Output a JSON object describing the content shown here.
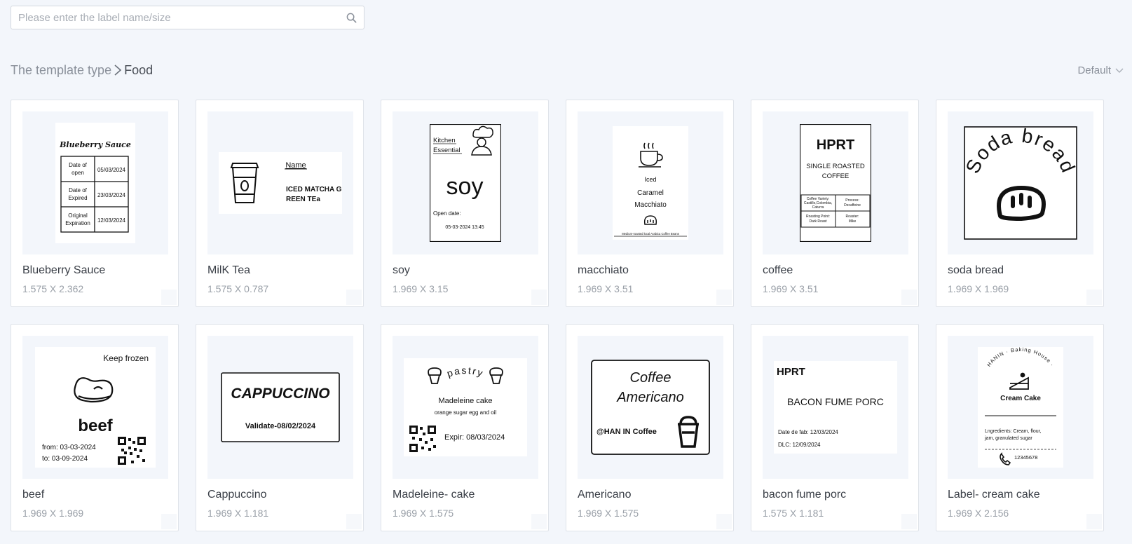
{
  "search": {
    "placeholder": "Please enter the label name/size",
    "icon": "search-icon"
  },
  "breadcrumb": {
    "root": "The template type",
    "current": "Food"
  },
  "sort": {
    "label": "Default"
  },
  "templates": [
    {
      "name": "Blueberry Sauce",
      "size": "1.575 X 2.362",
      "label": {
        "title": "Blueberry Sauce",
        "rows": [
          {
            "k": [
              "Date of",
              "open"
            ],
            "v": "05/03/2024"
          },
          {
            "k": [
              "Date of",
              "Expired"
            ],
            "v": "23/03/2024"
          },
          {
            "k": [
              "Original",
              "Expiration"
            ],
            "v": "12/03/2024"
          }
        ]
      }
    },
    {
      "name": "MilK Tea",
      "size": "1.575 X 0.787",
      "label": {
        "heading": "Name",
        "line1": "ICED MATCHA G",
        "line2": "REEN TEa"
      }
    },
    {
      "name": "soy",
      "size": "1.969 X 3.15",
      "label": {
        "top1": "Kitchen",
        "top2": "Essential",
        "big": "soy",
        "open": "Open date:",
        "date": "05-03-2024  13:45"
      }
    },
    {
      "name": "macchiato",
      "size": "1.969 X 3.51",
      "label": {
        "l1": "Iced",
        "l2": "Caramel",
        "l3": "Macchiato",
        "foot": "Medium-roasted local Arabica Coffee Beans"
      }
    },
    {
      "name": "coffee",
      "size": "1.969 X 3.51",
      "label": {
        "brand": "HPRT",
        "sub1": "SINGLE ROASTED",
        "sub2": "COFFEE",
        "c1a": "Coffee Variety:",
        "c1b": "Castillo,Colombia,",
        "c1c": "Caturra",
        "c2a": "Process:",
        "c2b": "Decaffeine",
        "c3a": "Roasting Point:",
        "c3b": "Dark Roast",
        "c4a": "Roaster:",
        "c4b": "Mike"
      }
    },
    {
      "name": "soda bread",
      "size": "1.969 X 1.969",
      "label": {
        "arc": "Soda bread"
      }
    },
    {
      "name": "beef",
      "size": "1.969 X 1.969",
      "label": {
        "top": "Keep frozen",
        "big": "beef",
        "from": "from: 03-03-2024",
        "to": "to: 03-09-2024"
      }
    },
    {
      "name": "Cappuccino",
      "size": "1.969 X 1.181",
      "label": {
        "big": "CAPPUCCINO",
        "sub": "Validate-08/02/2024"
      }
    },
    {
      "name": "Madeleine- cake",
      "size": "1.969 X 1.575",
      "label": {
        "arc": "pastry",
        "l1": "Madeleine cake",
        "l2": "orange sugar egg and oil",
        "exp": "Expir: 08/03/2024"
      }
    },
    {
      "name": "Americano",
      "size": "1.969 X 1.575",
      "label": {
        "l1": "Coffee",
        "l2": "Americano",
        "brand": "@HAN IN Coffee"
      }
    },
    {
      "name": "bacon fume porc",
      "size": "1.575 X 1.181",
      "label": {
        "brand": "HPRT",
        "big": "BACON FUME PORC",
        "d1": "Date de fab: 12/03/2024",
        "d2": "DLC: 12/09/2024"
      }
    },
    {
      "name": "Label- cream cake",
      "size": "1.969 X 2.156",
      "label": {
        "arc": "HANIN · Baking House ·",
        "title": "Cream Cake",
        "ing1": "Lngredients:  Cream,  flour,",
        "ing2": "jam,  granulated sugar",
        "phone": "12345678"
      }
    }
  ]
}
